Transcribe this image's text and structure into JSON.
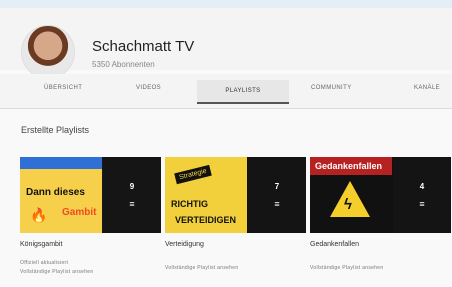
{
  "channel": {
    "name": "Schachmatt TV",
    "subscribers": "5350 Abonnenten"
  },
  "tabs": [
    "Übersicht",
    "Videos",
    "Playlists",
    "Community",
    "Kanäle"
  ],
  "section": {
    "title": "Erstellte Playlists"
  },
  "playlists": [
    {
      "title": "Königsgambit",
      "subtitle_1": "Offiziell aktualisiert",
      "subtitle_2": "Vollständige Playlist ansehen",
      "count": "9",
      "thumb_text_1": "Dann dieses",
      "thumb_text_2": "Gambit"
    },
    {
      "title": "Verteidigung",
      "subtitle_1": "Vollständige Playlist ansehen",
      "count": "7",
      "thumb_text_1": "Strategie",
      "thumb_text_2": "RICHTIG",
      "thumb_text_3": "VERTEIDIGEN"
    },
    {
      "title": "Gedankenfallen",
      "subtitle_1": "Vollständige Playlist ansehen",
      "count": "4",
      "thumb_text_1": "Gedankenfallen"
    }
  ],
  "icons": {
    "playlist": "list-icon",
    "flame": "flame-icon",
    "warning": "warning-icon"
  },
  "colors": {
    "yellow": "#f4cf2b",
    "blue": "#2f6fd6",
    "red": "#b62222"
  }
}
